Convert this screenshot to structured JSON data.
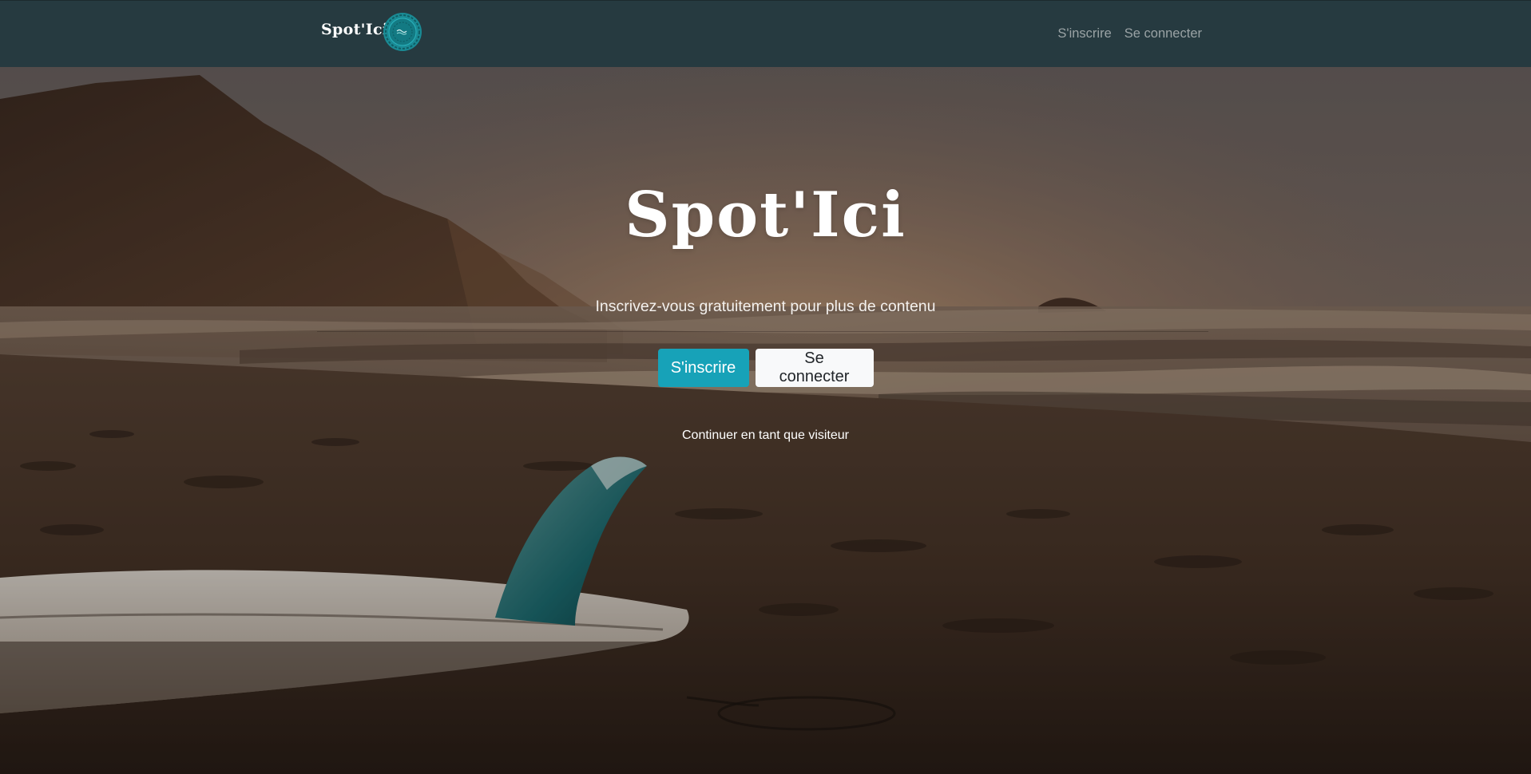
{
  "navbar": {
    "brand": "Spot'Ici",
    "logo_icon": "spotici-logo-icon",
    "links": [
      {
        "label": "S'inscrire"
      },
      {
        "label": "Se connecter"
      }
    ]
  },
  "hero": {
    "title": "Spot'Ici",
    "subtitle": "Inscrivez-vous gratuitement pour plus de contenu",
    "primary_button": "S'inscrire",
    "secondary_button": "Se connecter",
    "visitor_link": "Continuer en tant que visiteur",
    "background_image": "beach-sunset-surfboard-photo"
  },
  "colors": {
    "navbar_bg": "#263a40",
    "primary": "#17a2b8",
    "light_button": "#f8f9fa",
    "nav_link": "#9aa3a5"
  }
}
